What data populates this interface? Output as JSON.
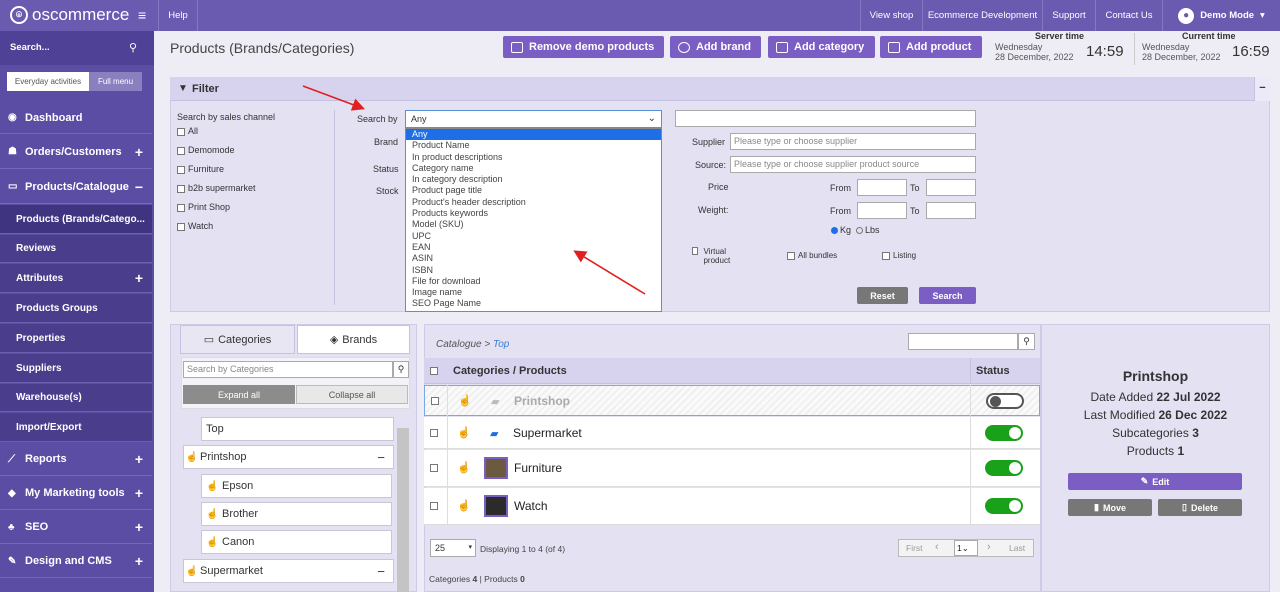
{
  "topbar": {
    "logo": "oscommerce",
    "help": "Help",
    "links": [
      "View shop",
      "Ecommerce Development",
      "Support",
      "Contact Us"
    ],
    "user": "Demo Mode"
  },
  "sidebar": {
    "search_placeholder": "Search...",
    "tab_everyday": "Everyday activities",
    "tab_full": "Full menu",
    "dashboard": "Dashboard",
    "orders": "Orders/Customers",
    "products": "Products/Catalogue",
    "subitems": [
      "Products (Brands/Catego...",
      "Reviews",
      "Attributes",
      "Products Groups",
      "Properties",
      "Suppliers",
      "Warehouse(s)",
      "Import/Export"
    ],
    "reports": "Reports",
    "marketing": "My Marketing tools",
    "seo": "SEO",
    "design": "Design and CMS"
  },
  "header": {
    "title": "Products (Brands/Categories)",
    "btn_remove_demo": "Remove demo products",
    "btn_add_brand": "Add brand",
    "btn_add_category": "Add category",
    "btn_add_product": "Add product",
    "server_time_label": "Server time",
    "server_day": "Wednesday",
    "server_date": "28 December, 2022",
    "server_time": "14:59",
    "current_time_label": "Current time",
    "current_day": "Wednesday",
    "current_date": "28 December, 2022",
    "current_time": "16:59"
  },
  "filter": {
    "title": "Filter",
    "collapse": "−",
    "sales_channel_label": "Search by sales channel",
    "channels": [
      "All",
      "Demomode",
      "Furniture",
      "b2b supermarket",
      "Print Shop",
      "Watch"
    ],
    "search_by_label": "Search by",
    "search_by_value": "Any",
    "brand_label": "Brand",
    "status_label": "Status",
    "stock_label": "Stock",
    "supplier_label": "Supplier",
    "supplier_placeholder": "Please type or choose supplier",
    "source_label": "Source:",
    "source_placeholder": "Please type or choose supplier product source",
    "price_label": "Price",
    "weight_label": "Weight:",
    "from_label": "From",
    "to_label": "To",
    "kg": "Kg",
    "lbs": "Lbs",
    "virtual": "Virtual product",
    "all_bundles": "All bundles",
    "listing": "Listing",
    "reset": "Reset",
    "search": "Search",
    "dropdown_options": [
      "Any",
      "Product Name",
      "In product descriptions",
      "Category name",
      "In category description",
      "Product page title",
      "Product's header description",
      "Products keywords",
      "Model (SKU)",
      "UPC",
      "EAN",
      "ASIN",
      "ISBN",
      "File for download",
      "Image name",
      "SEO Page Name"
    ]
  },
  "tree": {
    "tab_categories": "Categories",
    "tab_brands": "Brands",
    "search_placeholder": "Search by Categories",
    "expand_all": "Expand all",
    "collapse_all": "Collapse all",
    "items": [
      "Top",
      "Printshop",
      "Epson",
      "Brother",
      "Canon",
      "Supermarket"
    ]
  },
  "table": {
    "breadcrumb_root": "Catalogue",
    "breadcrumb_sep": ">",
    "breadcrumb_current": "Top",
    "col_name": "Categories / Products",
    "col_status": "Status",
    "rows": [
      "Printshop",
      "Supermarket",
      "Furniture",
      "Watch"
    ],
    "per_page": "25",
    "displaying": "Displaying 1 to 4 (of 4)",
    "first": "First",
    "last": "Last",
    "page": "1",
    "categories_label": "Categories",
    "categories_count": "4",
    "products_label": "Products",
    "products_count": "0"
  },
  "details": {
    "name": "Printshop",
    "date_added_label": "Date Added",
    "date_added": "22 Jul 2022",
    "modified_label": "Last Modified",
    "modified": "26 Dec 2022",
    "subcat_label": "Subcategories",
    "subcat": "3",
    "products_label": "Products",
    "products": "1",
    "edit": "Edit",
    "move": "Move",
    "delete": "Delete"
  },
  "colors": {
    "topbar": "#6a5bb0",
    "sidebar": "#5b4da3",
    "accent": "#7a5ec3",
    "toggle_on": "#1aa11a",
    "arrow": "#e02020"
  }
}
